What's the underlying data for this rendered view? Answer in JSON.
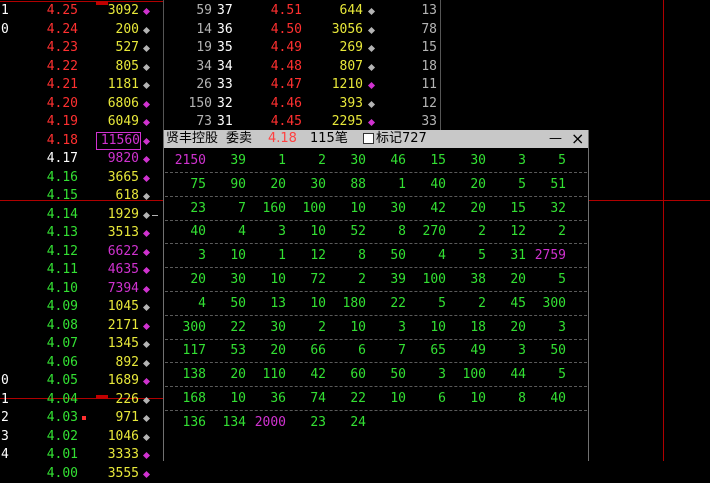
{
  "colors": {
    "red": "#ff3030",
    "green": "#33e033",
    "yellow": "#e8e83a",
    "white": "#ffffff",
    "magenta": "#d032d0",
    "gray": "#b4b4b4",
    "redline": "#b00000",
    "blue": "#7070ff",
    "cyan": "#40e0e0"
  },
  "left_rows": [
    {
      "n": "1",
      "price": "4.25",
      "price_c": "red",
      "vol": "3092",
      "mk": "magenta"
    },
    {
      "n": "0",
      "price": "4.24",
      "price_c": "red",
      "vol": "200",
      "mk": "gray"
    },
    {
      "n": "",
      "price": "4.23",
      "price_c": "red",
      "vol": "527",
      "mk": "gray"
    },
    {
      "n": "",
      "price": "4.22",
      "price_c": "red",
      "vol": "805",
      "mk": "gray"
    },
    {
      "n": "",
      "price": "4.21",
      "price_c": "red",
      "vol": "1181",
      "mk": "gray"
    },
    {
      "n": "",
      "price": "4.20",
      "price_c": "red",
      "vol": "6806",
      "mk": "magenta"
    },
    {
      "n": "",
      "price": "4.19",
      "price_c": "red",
      "vol": "6049",
      "mk": "magenta"
    },
    {
      "n": "",
      "price": "4.18",
      "price_c": "red",
      "vol": "11560",
      "mk": "magenta",
      "boxed": true,
      "vol_c": "magenta"
    },
    {
      "n": "",
      "price": "4.17",
      "price_c": "white",
      "vol": "9820",
      "mk": "magenta",
      "vol_c": "magenta"
    },
    {
      "n": "",
      "price": "4.16",
      "price_c": "green",
      "vol": "3665",
      "mk": "magenta"
    },
    {
      "n": "",
      "price": "4.15",
      "price_c": "green",
      "vol": "618",
      "mk": "gray"
    },
    {
      "n": "",
      "price": "4.14",
      "price_c": "green",
      "vol": "1929",
      "mk": "gray",
      "dash": true
    },
    {
      "n": "",
      "price": "4.13",
      "price_c": "green",
      "vol": "3513",
      "mk": "magenta"
    },
    {
      "n": "",
      "price": "4.12",
      "price_c": "green",
      "vol": "6622",
      "mk": "magenta",
      "vol_c": "magenta"
    },
    {
      "n": "",
      "price": "4.11",
      "price_c": "green",
      "vol": "4635",
      "mk": "magenta",
      "vol_c": "magenta"
    },
    {
      "n": "",
      "price": "4.10",
      "price_c": "green",
      "vol": "7394",
      "mk": "magenta",
      "vol_c": "magenta"
    },
    {
      "n": "",
      "price": "4.09",
      "price_c": "green",
      "vol": "1045",
      "mk": "gray"
    },
    {
      "n": "",
      "price": "4.08",
      "price_c": "green",
      "vol": "2171",
      "mk": "magenta"
    },
    {
      "n": "",
      "price": "4.07",
      "price_c": "green",
      "vol": "1345",
      "mk": "gray"
    },
    {
      "n": "",
      "price": "4.06",
      "price_c": "green",
      "vol": "892",
      "mk": "gray"
    },
    {
      "n": "0",
      "price": "4.05",
      "price_c": "green",
      "vol": "1689",
      "mk": "magenta"
    },
    {
      "n": "1",
      "price": "4.04",
      "price_c": "green",
      "vol": "226",
      "mk": "gray"
    },
    {
      "n": "2",
      "price": "4.03",
      "price_c": "green",
      "vol": "971",
      "mk": "gray",
      "redmark": true
    },
    {
      "n": "3",
      "price": "4.02",
      "price_c": "green",
      "vol": "1046",
      "mk": "gray"
    },
    {
      "n": "4",
      "price": "4.01",
      "price_c": "green",
      "vol": "3333",
      "mk": "magenta"
    },
    {
      "n": "",
      "price": "4.00",
      "price_c": "green",
      "vol": "3555",
      "mk": "magenta"
    }
  ],
  "mid_rows": [
    {
      "a": "59",
      "b": "37",
      "price": "4.51",
      "vol": "644",
      "mk": "gray",
      "n": "13"
    },
    {
      "a": "14",
      "b": "36",
      "price": "4.50",
      "vol": "3056",
      "mk": "gray",
      "n": "78"
    },
    {
      "a": "19",
      "b": "35",
      "price": "4.49",
      "vol": "269",
      "mk": "gray",
      "n": "15"
    },
    {
      "a": "34",
      "b": "34",
      "price": "4.48",
      "vol": "807",
      "mk": "gray",
      "n": "18"
    },
    {
      "a": "26",
      "b": "33",
      "price": "4.47",
      "vol": "1210",
      "mk": "magenta",
      "n": "11"
    },
    {
      "a": "150",
      "b": "32",
      "price": "4.46",
      "vol": "393",
      "mk": "gray",
      "n": "12"
    },
    {
      "a": "73",
      "b": "31",
      "price": "4.45",
      "vol": "2295",
      "mk": "magenta",
      "n": "33"
    }
  ],
  "popup": {
    "name": "贤丰控股",
    "type": "委卖",
    "price": "4.18",
    "count": "115笔",
    "mark_label": "标记727",
    "minimize": "—",
    "close": "×",
    "rows": [
      [
        [
          "2150",
          "magenta"
        ],
        [
          "39",
          "green"
        ],
        [
          "1",
          "green"
        ],
        [
          "2",
          "green"
        ],
        [
          "30",
          "green"
        ],
        [
          "46",
          "green"
        ],
        [
          "15",
          "green"
        ],
        [
          "30",
          "green"
        ],
        [
          "3",
          "green"
        ],
        [
          "5",
          "green"
        ]
      ],
      [
        [
          "75",
          "green"
        ],
        [
          "90",
          "green"
        ],
        [
          "20",
          "green"
        ],
        [
          "30",
          "green"
        ],
        [
          "88",
          "green"
        ],
        [
          "1",
          "green"
        ],
        [
          "40",
          "green"
        ],
        [
          "20",
          "green"
        ],
        [
          "5",
          "green"
        ],
        [
          "51",
          "green"
        ]
      ],
      [
        [
          "23",
          "green"
        ],
        [
          "7",
          "green"
        ],
        [
          "160",
          "green"
        ],
        [
          "100",
          "green"
        ],
        [
          "10",
          "green"
        ],
        [
          "30",
          "green"
        ],
        [
          "42",
          "green"
        ],
        [
          "20",
          "green"
        ],
        [
          "15",
          "green"
        ],
        [
          "32",
          "green"
        ]
      ],
      [
        [
          "40",
          "green"
        ],
        [
          "4",
          "green"
        ],
        [
          "3",
          "green"
        ],
        [
          "10",
          "green"
        ],
        [
          "52",
          "green"
        ],
        [
          "8",
          "green"
        ],
        [
          "270",
          "green"
        ],
        [
          "2",
          "green"
        ],
        [
          "12",
          "green"
        ],
        [
          "2",
          "green"
        ]
      ],
      [
        [
          "3",
          "green"
        ],
        [
          "10",
          "green"
        ],
        [
          "1",
          "green"
        ],
        [
          "12",
          "green"
        ],
        [
          "8",
          "green"
        ],
        [
          "50",
          "green"
        ],
        [
          "4",
          "green"
        ],
        [
          "5",
          "green"
        ],
        [
          "31",
          "green"
        ],
        [
          "2759",
          "magenta"
        ]
      ],
      [
        [
          "20",
          "green"
        ],
        [
          "30",
          "green"
        ],
        [
          "10",
          "green"
        ],
        [
          "72",
          "green"
        ],
        [
          "2",
          "green"
        ],
        [
          "39",
          "green"
        ],
        [
          "100",
          "green"
        ],
        [
          "38",
          "green"
        ],
        [
          "20",
          "green"
        ],
        [
          "5",
          "green"
        ]
      ],
      [
        [
          "4",
          "green"
        ],
        [
          "50",
          "green"
        ],
        [
          "13",
          "green"
        ],
        [
          "10",
          "green"
        ],
        [
          "180",
          "green"
        ],
        [
          "22",
          "green"
        ],
        [
          "5",
          "green"
        ],
        [
          "2",
          "green"
        ],
        [
          "45",
          "green"
        ],
        [
          "300",
          "green"
        ]
      ],
      [
        [
          "300",
          "green"
        ],
        [
          "22",
          "green"
        ],
        [
          "30",
          "green"
        ],
        [
          "2",
          "green"
        ],
        [
          "10",
          "green"
        ],
        [
          "3",
          "green"
        ],
        [
          "10",
          "green"
        ],
        [
          "18",
          "green"
        ],
        [
          "20",
          "green"
        ],
        [
          "3",
          "green"
        ]
      ],
      [
        [
          "117",
          "green"
        ],
        [
          "53",
          "green"
        ],
        [
          "20",
          "green"
        ],
        [
          "66",
          "green"
        ],
        [
          "6",
          "green"
        ],
        [
          "7",
          "green"
        ],
        [
          "65",
          "green"
        ],
        [
          "49",
          "green"
        ],
        [
          "3",
          "green"
        ],
        [
          "50",
          "green"
        ]
      ],
      [
        [
          "138",
          "green"
        ],
        [
          "20",
          "green"
        ],
        [
          "110",
          "green"
        ],
        [
          "42",
          "green"
        ],
        [
          "60",
          "green"
        ],
        [
          "50",
          "green"
        ],
        [
          "3",
          "green"
        ],
        [
          "100",
          "green"
        ],
        [
          "44",
          "green"
        ],
        [
          "5",
          "green"
        ]
      ],
      [
        [
          "168",
          "green"
        ],
        [
          "10",
          "green"
        ],
        [
          "36",
          "green"
        ],
        [
          "74",
          "green"
        ],
        [
          "22",
          "green"
        ],
        [
          "10",
          "green"
        ],
        [
          "6",
          "green"
        ],
        [
          "10",
          "green"
        ],
        [
          "8",
          "green"
        ],
        [
          "40",
          "green"
        ]
      ],
      [
        [
          "136",
          "green"
        ],
        [
          "134",
          "green"
        ],
        [
          "2000",
          "magenta"
        ],
        [
          "23",
          "green"
        ],
        [
          "24",
          "green"
        ]
      ]
    ]
  }
}
